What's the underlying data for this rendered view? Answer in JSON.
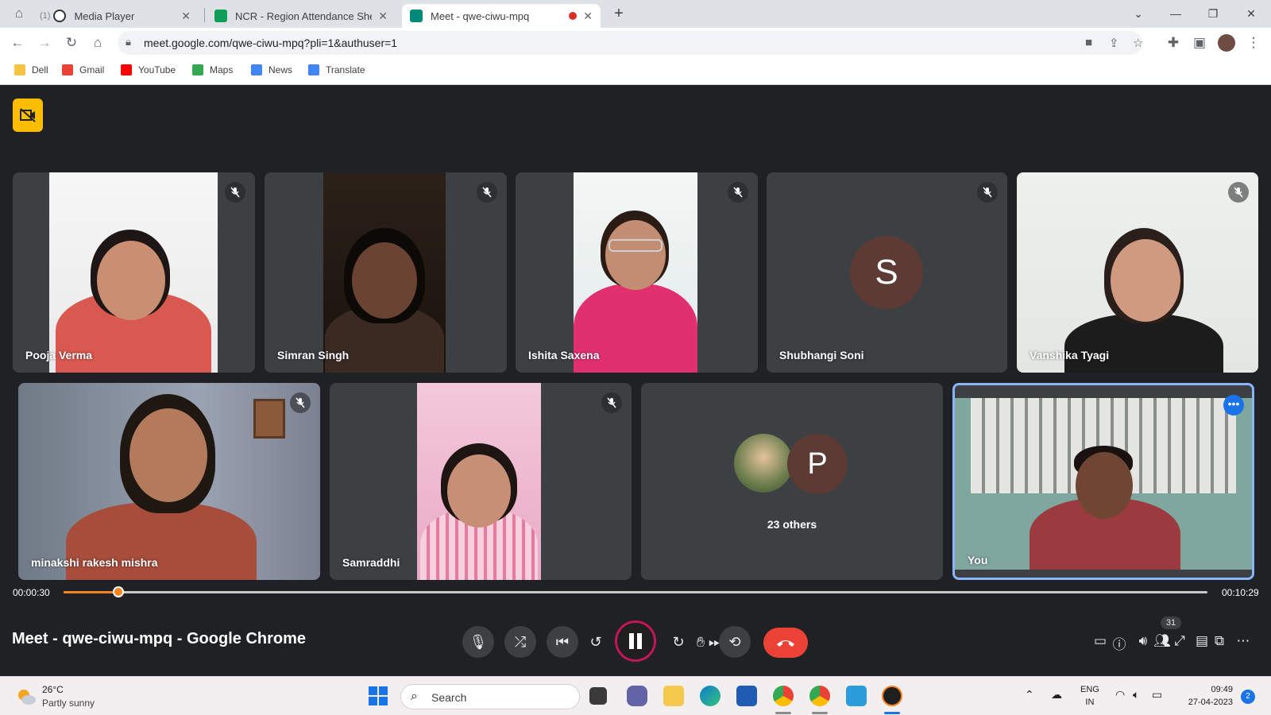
{
  "browser": {
    "tabs": [
      {
        "title": "Media Player",
        "prefix": "(1)"
      },
      {
        "title": "NCR - Region Attendance Sheet"
      },
      {
        "title": "Meet - qwe-ciwu-mpq"
      }
    ],
    "url": "meet.google.com/qwe-ciwu-mpq?pli=1&authuser=1",
    "bookmarks": [
      "Dell",
      "Gmail",
      "YouTube",
      "Maps",
      "News",
      "Translate"
    ]
  },
  "meet": {
    "participants": [
      {
        "name": "Pooja Verma"
      },
      {
        "name": "Simran Singh"
      },
      {
        "name": "Ishita Saxena"
      },
      {
        "name": "Shubhangi Soni",
        "initial": "S"
      },
      {
        "name": "Vanshika Tyagi"
      },
      {
        "name": "minakshi rakesh mishra"
      },
      {
        "name": "Samraddhi"
      },
      {
        "name": "23 others",
        "initial": "P"
      },
      {
        "name": "You"
      }
    ]
  },
  "player": {
    "elapsed": "00:00:30",
    "total": "00:10:29",
    "progress": 0.048,
    "window_title": "Meet - qwe-ciwu-mpq - Google Chrome",
    "participant_count": "31"
  },
  "taskbar": {
    "temperature": "26°C",
    "weather": "Partly sunny",
    "search_label": "Search",
    "lang_top": "ENG",
    "lang_bottom": "IN",
    "time": "09:49",
    "date": "27-04-2023",
    "notifications": "2"
  },
  "colors": {
    "meet_bg": "#202124",
    "tile_bg": "#3c4043",
    "accent_orange": "#f5831f",
    "hangup_red": "#ea4335",
    "highlight_blue": "#8ab4f8"
  }
}
